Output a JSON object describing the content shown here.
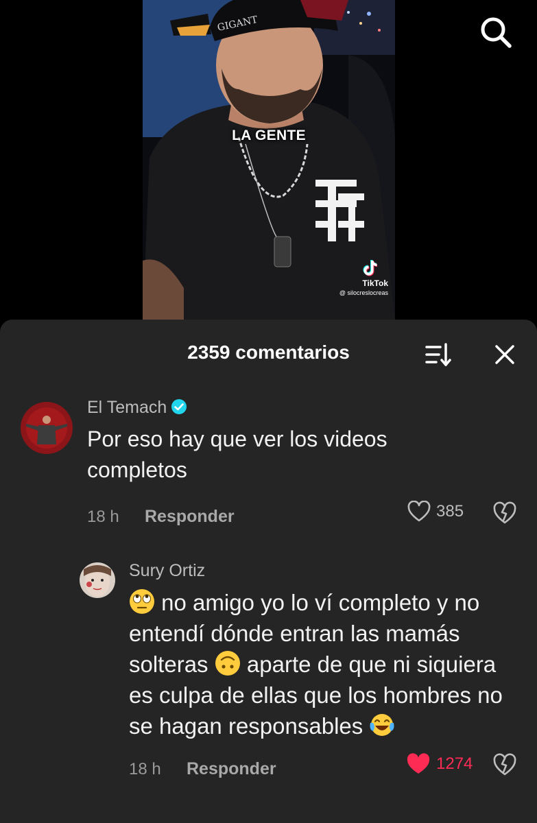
{
  "video": {
    "caption": "LA GENTE",
    "watermark_name": "TikTok",
    "watermark_handle": "@ silocreslocreas",
    "top_icon": "search-icon"
  },
  "comments_panel": {
    "title": "2359 comentarios",
    "sort_icon": "sort-icon",
    "close_icon": "close-icon"
  },
  "comments": [
    {
      "author": "El Temach",
      "verified": true,
      "text": "Por eso hay que ver los videos completos",
      "time": "18 h",
      "reply_label": "Responder",
      "likes": "385",
      "liked": false
    },
    {
      "author": "Sury Ortiz",
      "verified": false,
      "text_parts": [
        "no amigo yo lo ví completo y no entendí dónde entran las mamás solteras",
        "aparte de que ni siquiera es culpa de ellas que los hombres no se hagan responsables"
      ],
      "emojis": [
        "face-with-rolling-eyes-emoji",
        "upside-down-face-emoji",
        "face-with-tears-of-joy-emoji"
      ],
      "time": "18 h",
      "reply_label": "Responder",
      "likes": "1274",
      "liked": true
    }
  ],
  "colors": {
    "sheet_bg": "#252525",
    "liked_heart": "#fe2c55",
    "verified_badge": "#20d5ec"
  }
}
